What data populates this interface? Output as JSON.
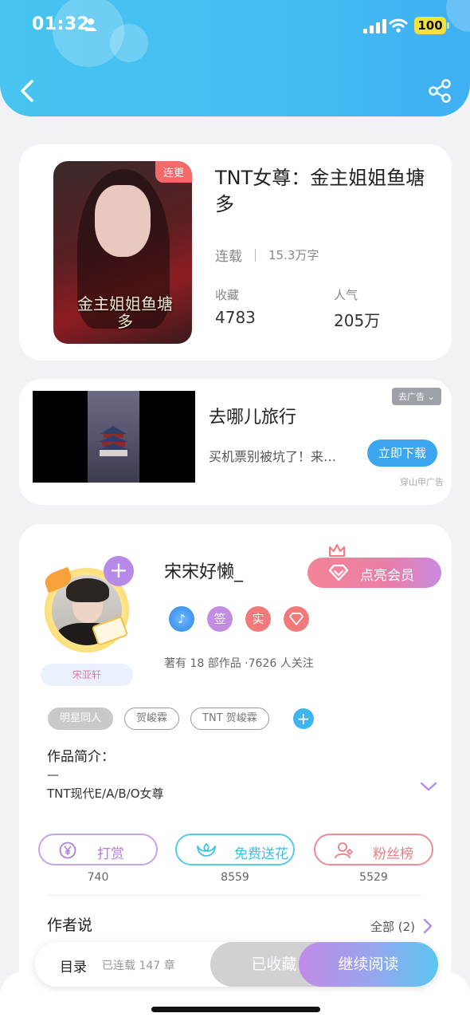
{
  "status_bar": {
    "time": "01:32",
    "battery": "100"
  },
  "book": {
    "cover_badge": "连更",
    "cover_title": "金主姐姐鱼塘多",
    "title": "TNT女尊：金主姐姐鱼塘多",
    "status": "连载",
    "word_count": "15.3万字",
    "favorites_label": "收藏",
    "favorites_value": "4783",
    "popularity_label": "人气",
    "popularity_value": "205万"
  },
  "ad": {
    "title": "去哪儿旅行",
    "description": "买机票别被坑了！来…",
    "download_label": "立即下载",
    "close_label": "去广告",
    "source": "穿山甲广告"
  },
  "author": {
    "name": "宋宋好懒_",
    "avatar_tag": "宋亚轩",
    "vip_label": "点亮会员",
    "badges": {
      "music": "",
      "sign": "签",
      "real": "实",
      "gem": ""
    },
    "works_line": "著有 18 部作品 ·7626 人关注",
    "tags": [
      "明星同人",
      "贺峻霖",
      "TNT 贺峻霖"
    ],
    "intro_label": "作品简介：",
    "intro_dash": "—",
    "intro_text": "TNT现代E/A/B/O女尊"
  },
  "actions": {
    "reward_label": "打赏",
    "reward_count": "740",
    "flower_label": "免费送花",
    "flower_count": "8559",
    "fans_label": "粉丝榜",
    "fans_count": "5529"
  },
  "author_says": {
    "label": "作者说",
    "all_label": "全部 (2)"
  },
  "bottom_bar": {
    "toc_label": "目录",
    "chapters": "已连载 147 章",
    "collected_label": "已收藏",
    "read_label": "继续阅读"
  },
  "colors": {
    "header": "#43bdf2",
    "accent_purple": "#b789e8",
    "accent_blue": "#3ba6ef",
    "accent_red": "#f27979"
  }
}
